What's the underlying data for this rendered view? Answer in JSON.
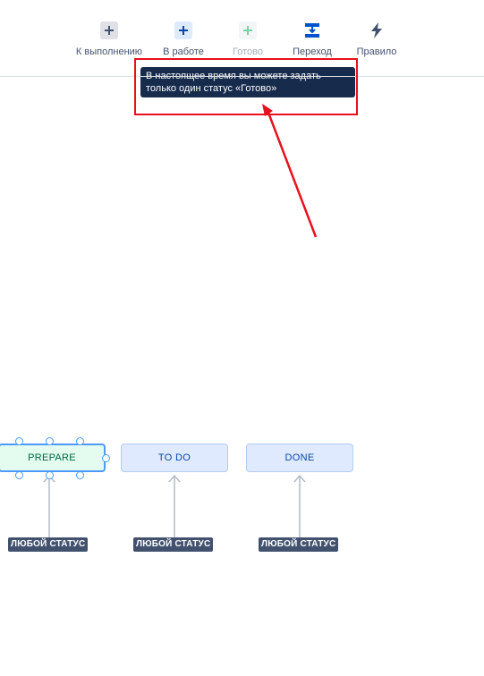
{
  "toolbar": {
    "items": [
      {
        "label": "К выполнению",
        "icon": "plus-icon",
        "enabled": true
      },
      {
        "label": "В работе",
        "icon": "plus-icon",
        "enabled": true
      },
      {
        "label": "Готово",
        "icon": "plus-icon",
        "enabled": false
      },
      {
        "label": "Переход",
        "icon": "transition-icon",
        "enabled": true
      },
      {
        "label": "Правило",
        "icon": "lightning-icon",
        "enabled": true
      }
    ]
  },
  "tooltip": {
    "line1": "В настоящее время вы можете задать",
    "line2": "только один статус «Готово»"
  },
  "workflow": {
    "statuses": [
      {
        "label": "PREPARE",
        "category": "selected"
      },
      {
        "label": "TO DO",
        "category": "todo"
      },
      {
        "label": "DONE",
        "category": "todo"
      }
    ],
    "any_status_label": "ЛЮБОЙ СТАТУС"
  },
  "colors": {
    "accent": "#4c9aff",
    "annotation_red": "#e8101c",
    "tooltip_bg": "#172b4d",
    "badge_bg": "#42526e"
  }
}
